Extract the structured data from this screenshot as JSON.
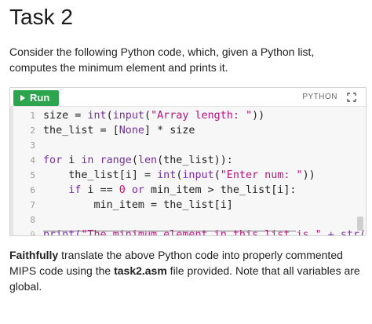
{
  "page": {
    "title": "Task 2",
    "intro": "Consider the following Python code, which, given a Python list, computes the minimum element and prints it."
  },
  "widget": {
    "run_label": "Run",
    "language": "PYTHON",
    "icons": {
      "run": "play-icon",
      "expand": "expand-icon",
      "cursor": "text-cursor-icon"
    },
    "code_lines": [
      {
        "n": "1",
        "tokens": [
          {
            "t": "size = ",
            "k": ""
          },
          {
            "t": "int",
            "k": "bi"
          },
          {
            "t": "(",
            "k": ""
          },
          {
            "t": "input",
            "k": "bi"
          },
          {
            "t": "(",
            "k": ""
          },
          {
            "t": "\"Array length: \"",
            "k": "str"
          },
          {
            "t": "))",
            "k": ""
          }
        ]
      },
      {
        "n": "2",
        "tokens": [
          {
            "t": "the_list = [",
            "k": ""
          },
          {
            "t": "None",
            "k": "kw"
          },
          {
            "t": "] * size",
            "k": ""
          }
        ]
      },
      {
        "n": "3",
        "tokens": []
      },
      {
        "n": "4",
        "tokens": [
          {
            "t": "for",
            "k": "kw"
          },
          {
            "t": " i ",
            "k": ""
          },
          {
            "t": "in",
            "k": "kw"
          },
          {
            "t": " ",
            "k": ""
          },
          {
            "t": "range",
            "k": "bi"
          },
          {
            "t": "(",
            "k": ""
          },
          {
            "t": "len",
            "k": "bi"
          },
          {
            "t": "(the_list)):",
            "k": ""
          }
        ]
      },
      {
        "n": "5",
        "tokens": [
          {
            "t": "    the_list[i] = ",
            "k": ""
          },
          {
            "t": "int",
            "k": "bi"
          },
          {
            "t": "(",
            "k": ""
          },
          {
            "t": "input",
            "k": "bi"
          },
          {
            "t": "(",
            "k": ""
          },
          {
            "t": "\"Enter num: \"",
            "k": "str"
          },
          {
            "t": "))",
            "k": ""
          }
        ]
      },
      {
        "n": "6",
        "tokens": [
          {
            "t": "    ",
            "k": ""
          },
          {
            "t": "if",
            "k": "kw"
          },
          {
            "t": " i == ",
            "k": ""
          },
          {
            "t": "0",
            "k": "num"
          },
          {
            "t": " ",
            "k": ""
          },
          {
            "t": "or",
            "k": "kw"
          },
          {
            "t": " min_item > the_list[i]:",
            "k": ""
          }
        ]
      },
      {
        "n": "7",
        "tokens": [
          {
            "t": "        min_item = the_list[i]",
            "k": ""
          }
        ]
      },
      {
        "n": "8",
        "tokens": []
      },
      {
        "n": "9",
        "tokens": [
          {
            "t": "print",
            "k": "bi"
          },
          {
            "t": "(",
            "k": ""
          },
          {
            "t": "\"The minimum element in this list is \"",
            "k": "str"
          },
          {
            "t": " + ",
            "k": ""
          },
          {
            "t": "str",
            "k": "bi"
          },
          {
            "t": "(",
            "k": ""
          }
        ]
      }
    ]
  },
  "task": {
    "bold_1": "Faithfully",
    "text_1": " translate the above Python code into properly commented MIPS code using the ",
    "bold_2": "task2.asm",
    "text_2": " file provided. Note that all variables are global."
  },
  "colors": {
    "run_button": "#2da44e",
    "keyword": "#7a2ca6",
    "string": "#b5127d",
    "number": "#e6006e",
    "editor_bg": "#f7f7f7"
  }
}
